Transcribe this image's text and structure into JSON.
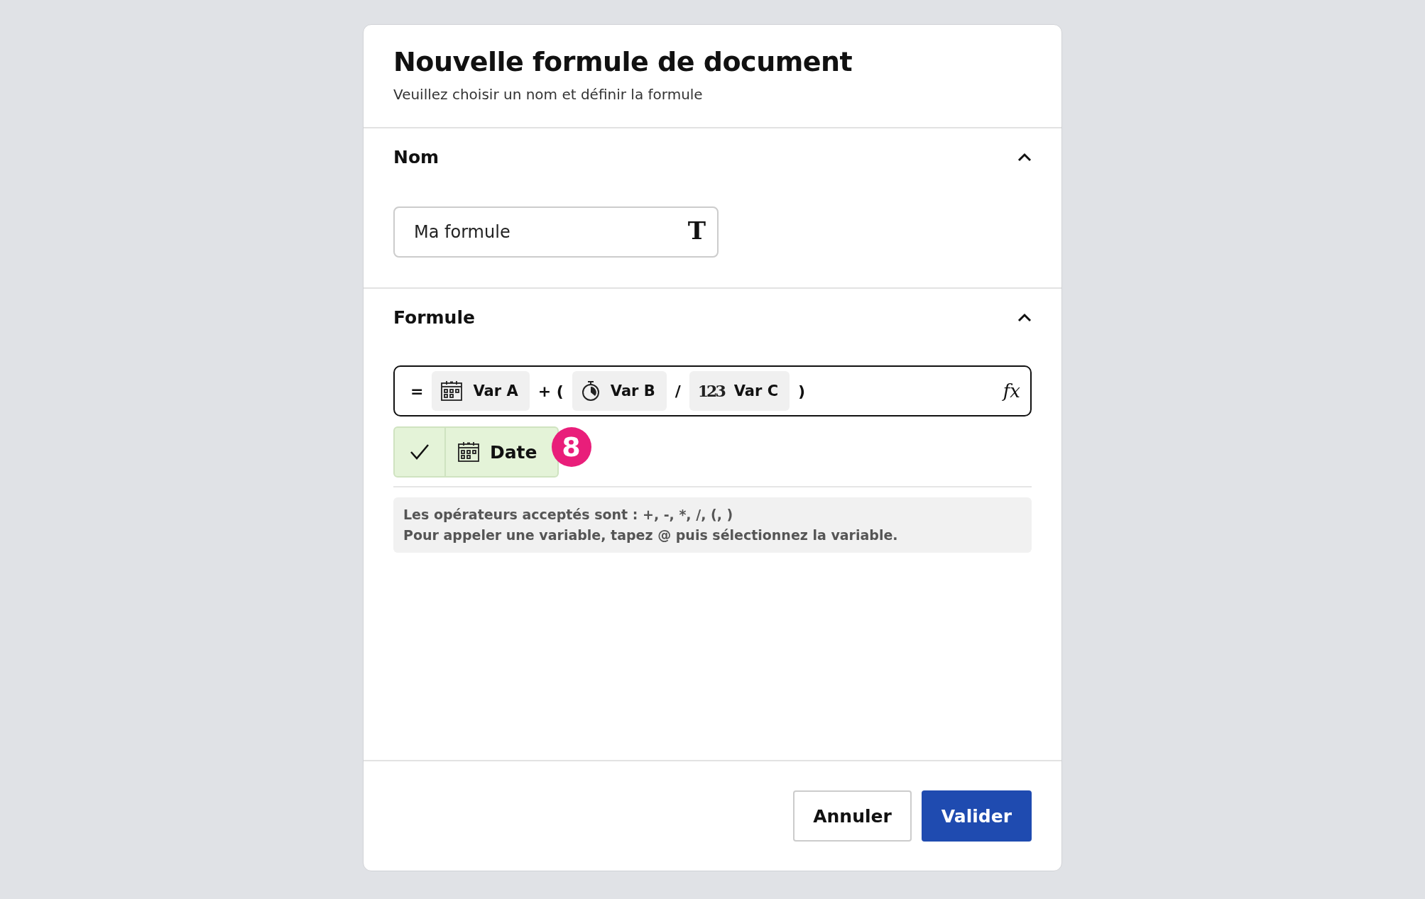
{
  "dialog": {
    "title": "Nouvelle formule de document",
    "subtitle": "Veuillez choisir un nom et définir la formule"
  },
  "name_section": {
    "title": "Nom",
    "expanded": true,
    "value": "Ma formule",
    "type_glyph": "T"
  },
  "formula_section": {
    "title": "Formule",
    "expanded": true,
    "tokens": [
      {
        "kind": "operator",
        "text": "="
      },
      {
        "kind": "date",
        "text": "Var A"
      },
      {
        "kind": "operator",
        "text": "+ ("
      },
      {
        "kind": "duration",
        "text": "Var B"
      },
      {
        "kind": "operator",
        "text": "/"
      },
      {
        "kind": "number",
        "glyph": "123",
        "text": "Var C"
      },
      {
        "kind": "operator",
        "text": ")"
      }
    ],
    "fx_glyph": "fx",
    "result": {
      "valid": true,
      "kind": "date",
      "text": "Date",
      "badge": "8"
    },
    "help": [
      "Les opérateurs acceptés sont : +, -, *, /, (, )",
      "Pour appeler une variable, tapez @ puis sélectionnez la variable."
    ]
  },
  "buttons": [
    {
      "kind": "secondary",
      "label": "Annuler"
    },
    {
      "kind": "primary",
      "label": "Valider"
    }
  ]
}
